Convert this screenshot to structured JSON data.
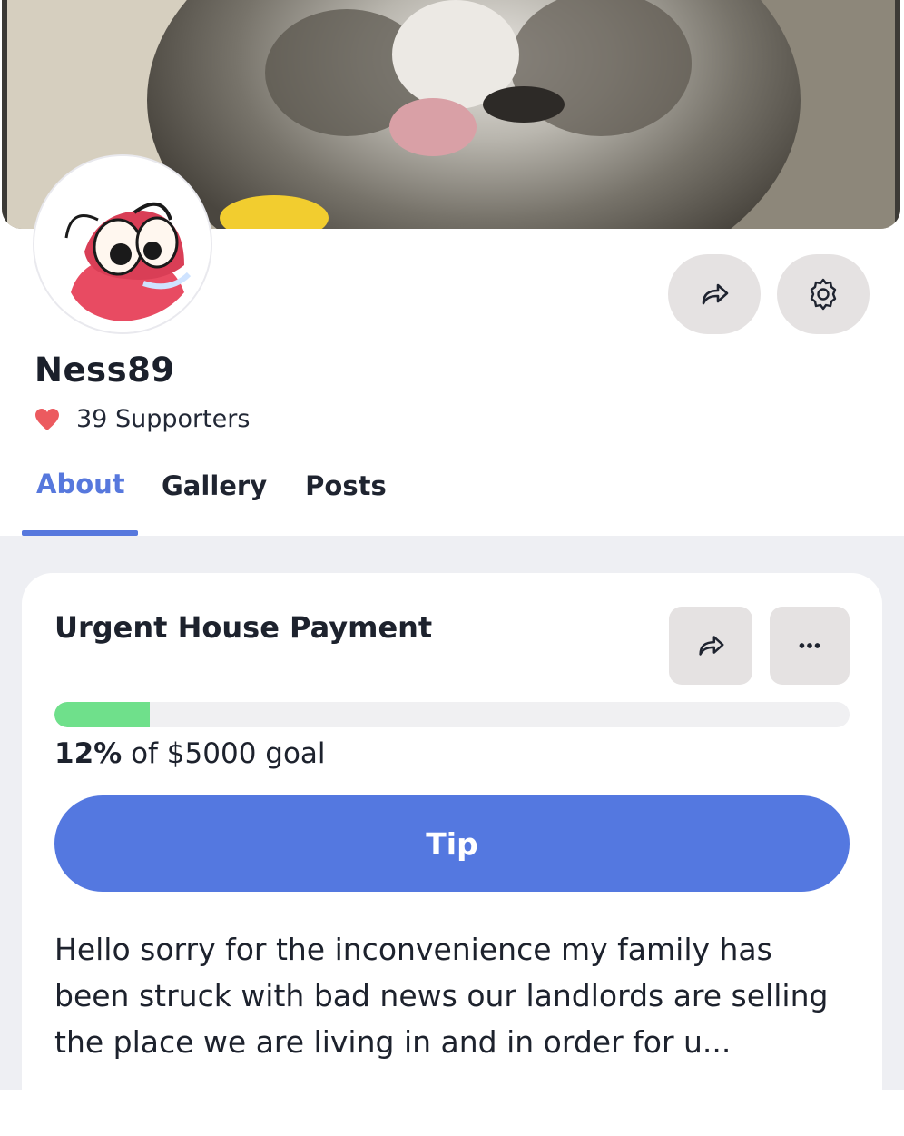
{
  "profile": {
    "name": "Ness89",
    "supporters": "39 Supporters"
  },
  "tabs": [
    {
      "label": "About",
      "active": true
    },
    {
      "label": "Gallery",
      "active": false
    },
    {
      "label": "Posts",
      "active": false
    }
  ],
  "campaign": {
    "title": "Urgent House Payment",
    "percent": "12%",
    "goal_suffix": "of $5000 goal",
    "progress_fraction": 0.12,
    "tip_label": "Tip",
    "description": "Hello sorry for the inconvenience my family has been struck with bad news our landlords are selling the place we are living in and in order for u..."
  },
  "icons": {
    "share": "share-icon",
    "settings": "gear-icon",
    "more": "more-dots-icon",
    "heart": "heart-icon"
  },
  "colors": {
    "accent": "#5778dd",
    "tip_button": "#5478e0",
    "progress": "#6fe08b",
    "heart": "#ec5a5f",
    "button_bg": "#e5e2e2"
  }
}
